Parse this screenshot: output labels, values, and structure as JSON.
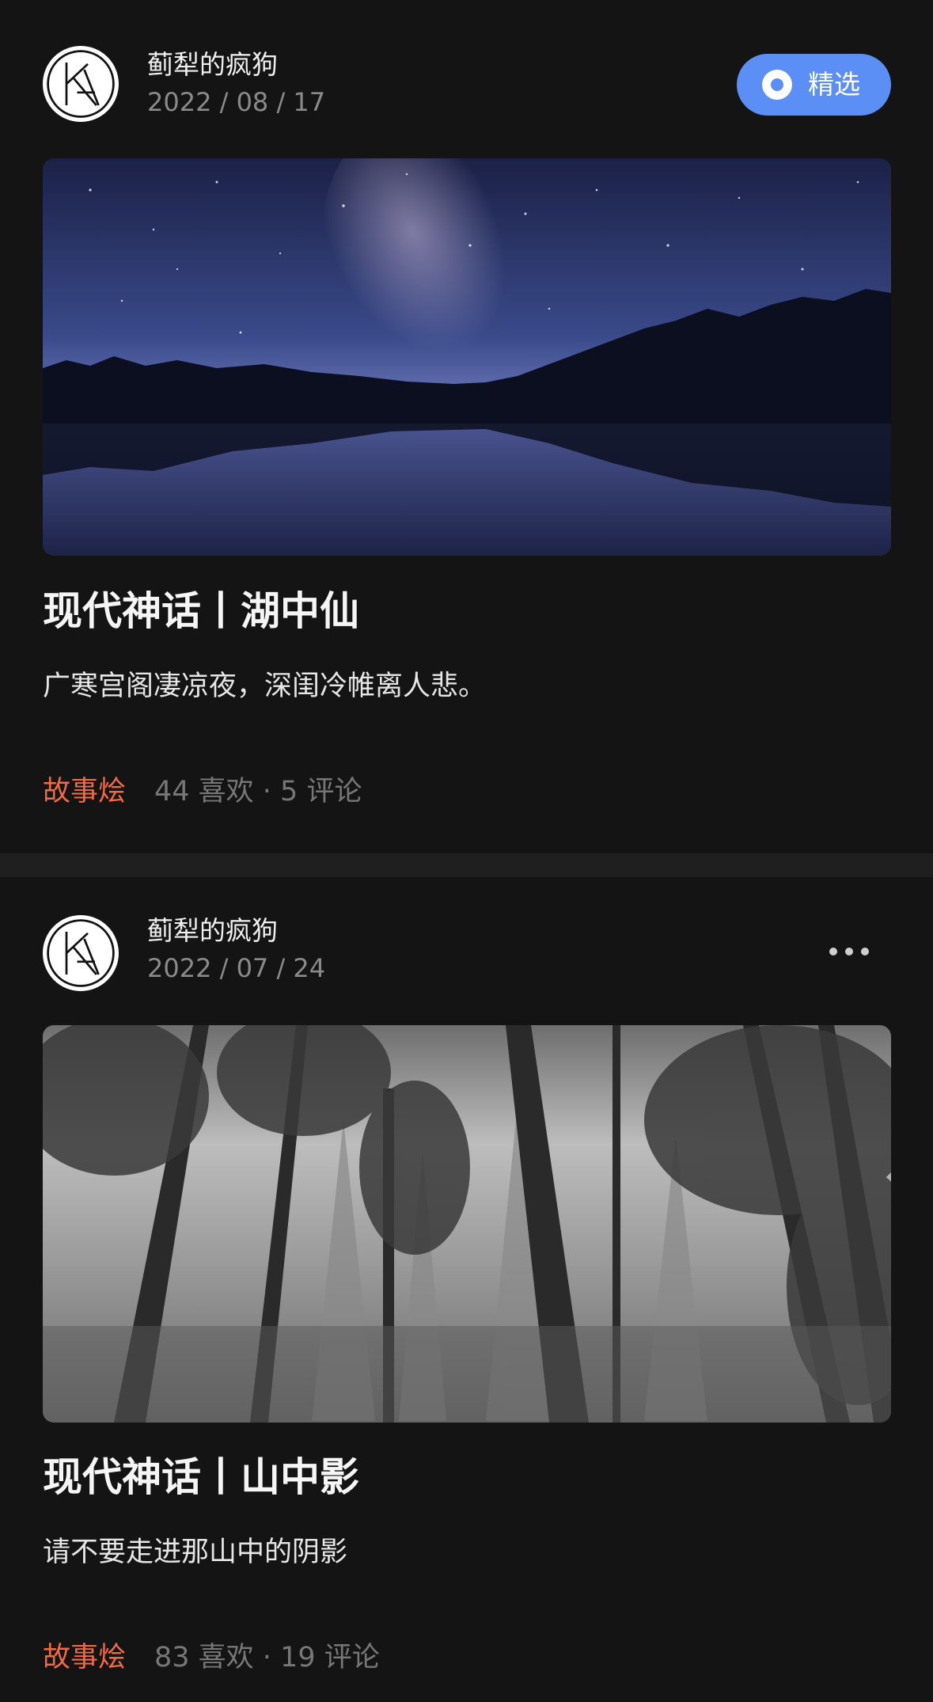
{
  "feed": {
    "posts": [
      {
        "author": "蓟犁的疯狗",
        "date": "2022 / 08 / 17",
        "badge": "精选",
        "title": "现代神话丨湖中仙",
        "summary": "广寒宫阁凄凉夜，深闺冷帷离人悲。",
        "category": "故事烩",
        "stats": "44 喜欢 · 5 评论",
        "cover_description_icon": "starry-lake-image"
      },
      {
        "author": "蓟犁的疯狗",
        "date": "2022 / 07 / 24",
        "title": "现代神话丨山中影",
        "summary": "请不要走进那山中的阴影",
        "category": "故事烩",
        "stats": "83 喜欢 · 19 评论",
        "cover_description_icon": "foggy-forest-image"
      }
    ]
  },
  "colors": {
    "background": "#141414",
    "separator": "#1f1f1f",
    "badge": "#5b8ff5",
    "category": "#f06a43",
    "muted": "#8a8a8a"
  }
}
